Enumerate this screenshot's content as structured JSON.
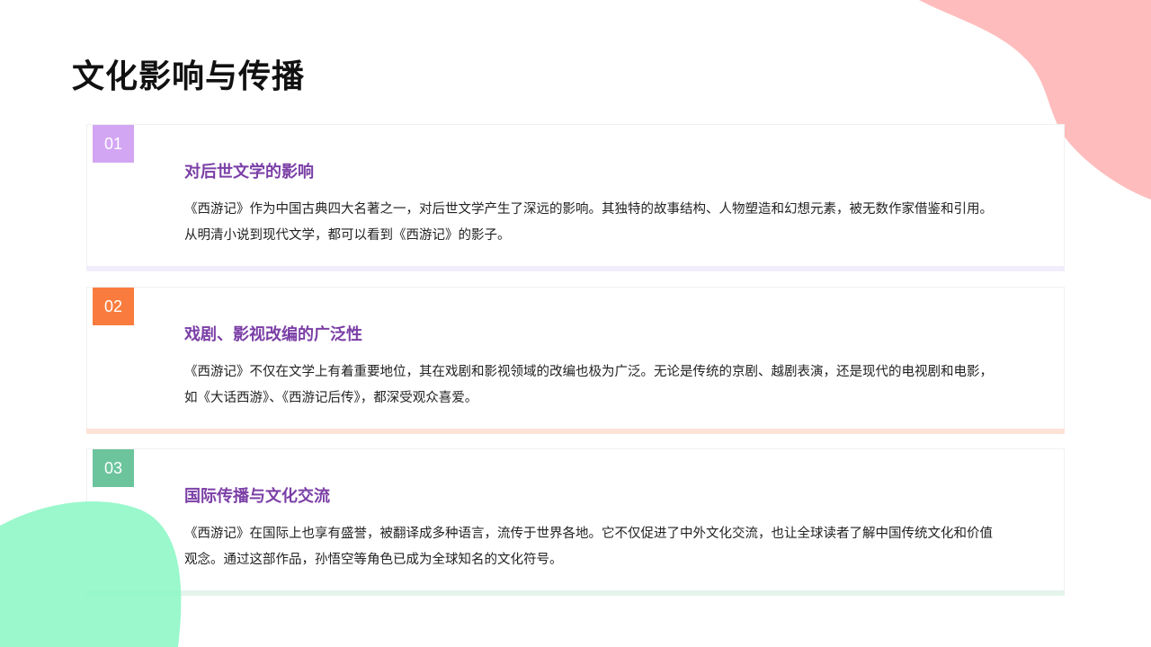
{
  "slide": {
    "title": "文化影响与传播",
    "colors": {
      "decor_pink": "#ffbcbc",
      "decor_green": "#8ff7c6",
      "title_purple": "#7b3fa6"
    }
  },
  "sections": [
    {
      "number": "01",
      "title": "对后世文学的影响",
      "body": "《西游记》作为中国古典四大名著之一，对后世文学产生了深远的影响。其独特的故事结构、人物塑造和幻想元素，被无数作家借鉴和引用。从明清小说到现代文学，都可以看到《西游记》的影子。",
      "badge_color": "#d3a6f3",
      "bar_color": "#f1edfc"
    },
    {
      "number": "02",
      "title": "戏剧、影视改编的广泛性",
      "body": "《西游记》不仅在文学上有着重要地位，其在戏剧和影视领域的改编也极为广泛。无论是传统的京剧、越剧表演，还是现代的电视剧和电影，如《大话西游》、《西游记后传》，都深受观众喜爱。",
      "badge_color": "#f97c3e",
      "bar_color": "#fde2d6"
    },
    {
      "number": "03",
      "title": "国际传播与文化交流",
      "body": "《西游记》在国际上也享有盛誉，被翻译成多种语言，流传于世界各地。它不仅促进了中外文化交流，也让全球读者了解中国传统文化和价值观念。通过这部作品，孙悟空等角色已成为全球知名的文化符号。",
      "badge_color": "#6cc49d",
      "bar_color": "#e3f4ec"
    }
  ]
}
